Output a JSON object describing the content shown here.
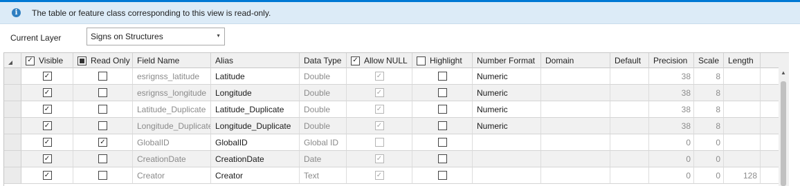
{
  "info": {
    "icon": "info-icon",
    "message": "The table or feature class corresponding to this view is read-only."
  },
  "layer": {
    "label": "Current Layer",
    "selected": "Signs on Structures"
  },
  "columns": {
    "visible": "Visible",
    "read_only": "Read Only",
    "field_name": "Field Name",
    "alias": "Alias",
    "data_type": "Data Type",
    "allow_null": "Allow NULL",
    "highlight": "Highlight",
    "number_format": "Number Format",
    "domain": "Domain",
    "default": "Default",
    "precision": "Precision",
    "scale": "Scale",
    "length": "Length"
  },
  "rows": [
    {
      "visible": true,
      "read_only": false,
      "field_name": "esrignss_latitude",
      "alias": "Latitude",
      "data_type": "Double",
      "allow_null": true,
      "allow_null_enabled": false,
      "highlight": false,
      "number_format": "Numeric",
      "domain": "",
      "default": "",
      "precision": "38",
      "scale": "8",
      "length": ""
    },
    {
      "visible": true,
      "read_only": false,
      "field_name": "esrignss_longitude",
      "alias": "Longitude",
      "data_type": "Double",
      "allow_null": true,
      "allow_null_enabled": false,
      "highlight": false,
      "number_format": "Numeric",
      "domain": "",
      "default": "",
      "precision": "38",
      "scale": "8",
      "length": ""
    },
    {
      "visible": true,
      "read_only": false,
      "field_name": "Latitude_Duplicate",
      "alias": "Latitude_Duplicate",
      "data_type": "Double",
      "allow_null": true,
      "allow_null_enabled": false,
      "highlight": false,
      "number_format": "Numeric",
      "domain": "",
      "default": "",
      "precision": "38",
      "scale": "8",
      "length": ""
    },
    {
      "visible": true,
      "read_only": false,
      "field_name": "Longitude_Duplicate",
      "alias": "Longitude_Duplicate",
      "data_type": "Double",
      "allow_null": true,
      "allow_null_enabled": false,
      "highlight": false,
      "number_format": "Numeric",
      "domain": "",
      "default": "",
      "precision": "38",
      "scale": "8",
      "length": ""
    },
    {
      "visible": true,
      "read_only": true,
      "field_name": "GlobalID",
      "alias": "GlobalID",
      "data_type": "Global ID",
      "allow_null": false,
      "allow_null_enabled": false,
      "highlight": false,
      "number_format": "",
      "domain": "",
      "default": "",
      "precision": "0",
      "scale": "0",
      "length": ""
    },
    {
      "visible": true,
      "read_only": false,
      "field_name": "CreationDate",
      "alias": "CreationDate",
      "data_type": "Date",
      "allow_null": true,
      "allow_null_enabled": false,
      "highlight": false,
      "number_format": "",
      "domain": "",
      "default": "",
      "precision": "0",
      "scale": "0",
      "length": ""
    },
    {
      "visible": true,
      "read_only": false,
      "field_name": "Creator",
      "alias": "Creator",
      "data_type": "Text",
      "allow_null": true,
      "allow_null_enabled": false,
      "highlight": false,
      "number_format": "",
      "domain": "",
      "default": "",
      "precision": "0",
      "scale": "0",
      "length": "128"
    }
  ],
  "colors": {
    "accent": "#0078d4",
    "info_bg": "#dcebf7",
    "header_bg": "#f0f0f0",
    "alt_row_bg": "#f1f1f1"
  }
}
